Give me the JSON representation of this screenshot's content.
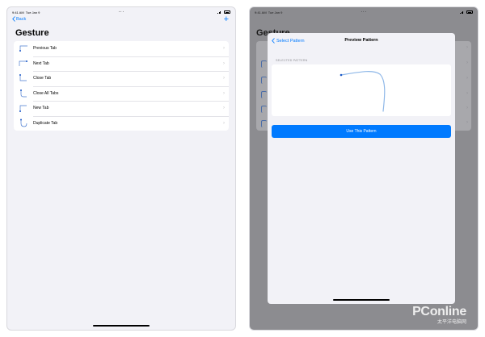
{
  "left_screen": {
    "status": {
      "time": "9:41 AM",
      "date": "Tue Jan 9"
    },
    "back_label": "Back",
    "add_label": "+",
    "title": "Gesture",
    "rows": [
      {
        "label": "Previous Tab",
        "icon": "gesture-previous-tab-icon"
      },
      {
        "label": "Next Tab",
        "icon": "gesture-next-tab-icon"
      },
      {
        "label": "Close Tab",
        "icon": "gesture-close-tab-icon"
      },
      {
        "label": "Close All Tabs",
        "icon": "gesture-close-all-tabs-icon"
      },
      {
        "label": "New Tab",
        "icon": "gesture-new-tab-icon"
      },
      {
        "label": "Duplicate Tab",
        "icon": "gesture-duplicate-tab-icon"
      }
    ]
  },
  "right_screen": {
    "status": {
      "time": "9:41 AM",
      "date": "Tue Jan 9"
    },
    "background_title": "Gesture",
    "sheet": {
      "back_label": "Select Pattern",
      "title": "Preview Pattern",
      "section_header": "SELECTED PATTERN",
      "button_label": "Use This Pattern"
    }
  },
  "watermark": {
    "main": "PConline",
    "sub": "太平洋电脑网"
  },
  "colors": {
    "accent": "#007aff",
    "background": "#f2f2f7",
    "dim_overlay": "#8c8c90"
  }
}
